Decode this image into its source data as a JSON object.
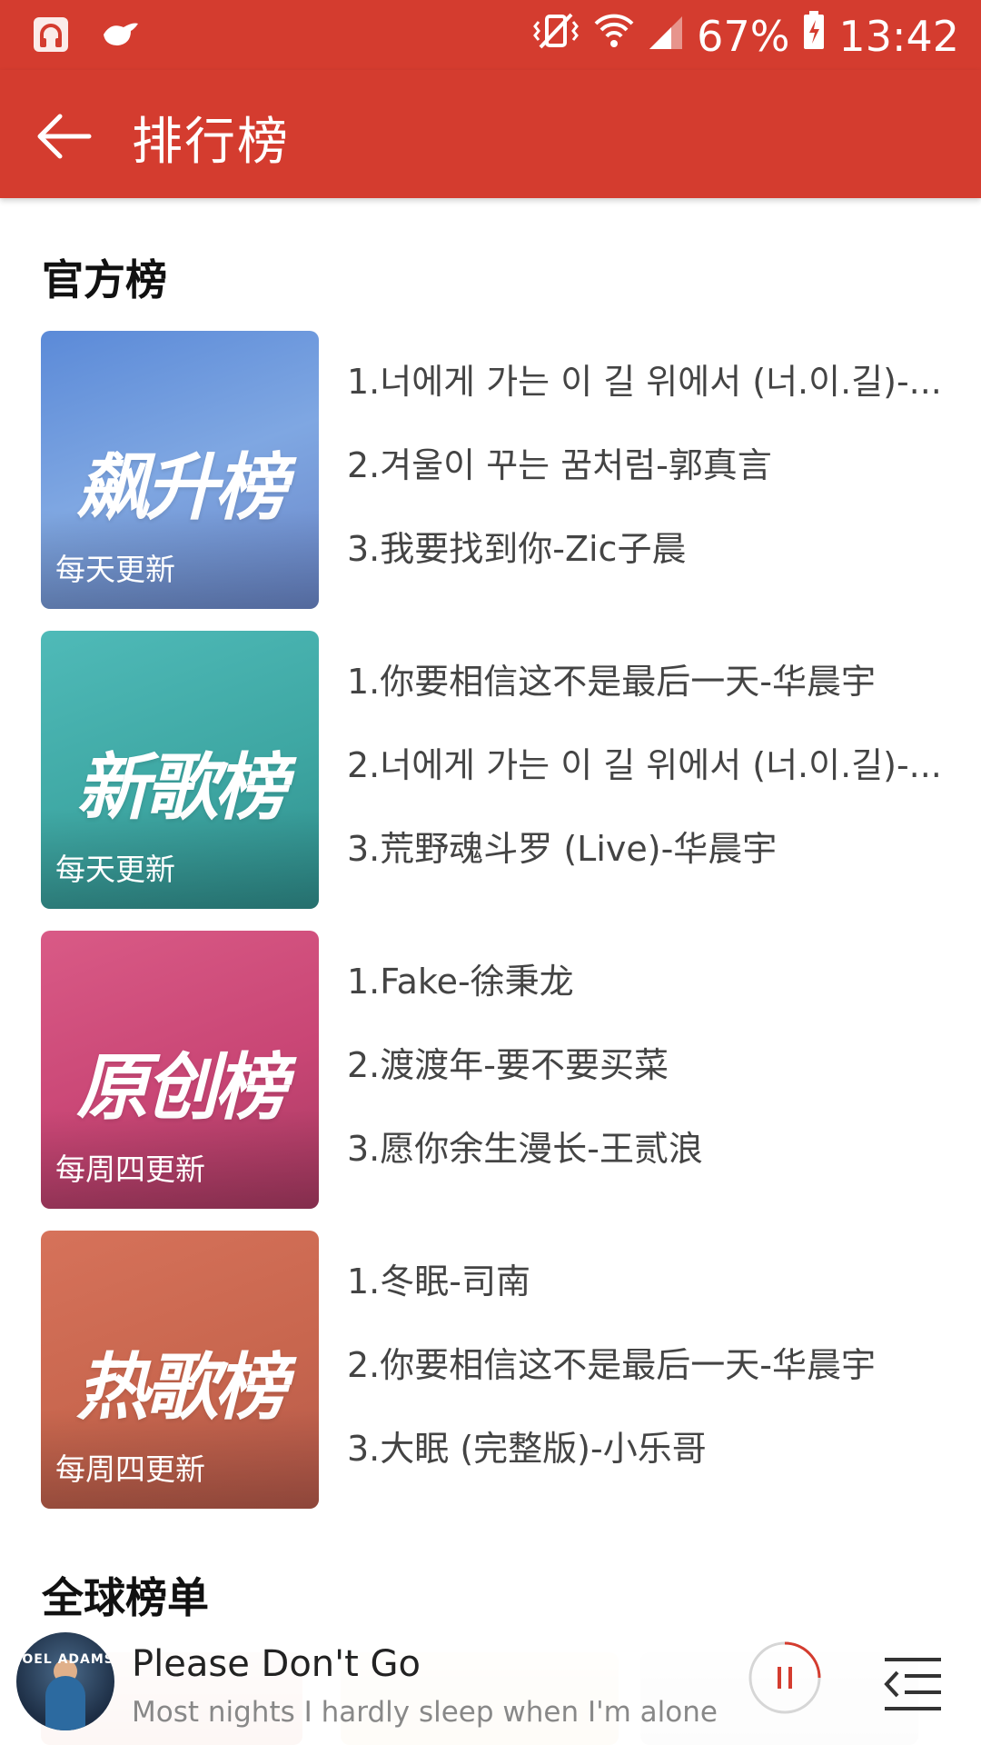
{
  "status_bar": {
    "battery": "67%",
    "time": "13:42"
  },
  "app_bar": {
    "title": "排行榜"
  },
  "sections": {
    "official_title": "官方榜",
    "global_title": "全球榜单"
  },
  "charts": [
    {
      "cover_title": "飙升榜",
      "update_text": "每天更新",
      "gradient": [
        "#5b8ad8",
        "#7fa7e2",
        "#6a86c8"
      ],
      "songs": [
        "1.너에게 가는 이 길 위에서 (너.이.길)-...",
        "2.겨울이 꾸는 꿈처럼-郭真言",
        "3.我要找到你-Zic子晨"
      ]
    },
    {
      "cover_title": "新歌榜",
      "update_text": "每天更新",
      "gradient": [
        "#4fbab8",
        "#3ea7a3",
        "#2f8e8c"
      ],
      "songs": [
        "1.你要相信这不是最后一天-华晨宇",
        "2.너에게 가는 이 길 위에서 (너.이.길)-...",
        "3.荒野魂斗罗 (Live)-华晨宇"
      ]
    },
    {
      "cover_title": "原创榜",
      "update_text": "每周四更新",
      "gradient": [
        "#d95a86",
        "#c94675",
        "#a83a62"
      ],
      "songs": [
        "1.Fake-徐秉龙",
        "2.渡渡年-要不要买菜",
        "3.愿你余生漫长-王贰浪"
      ]
    },
    {
      "cover_title": "热歌榜",
      "update_text": "每周四更新",
      "gradient": [
        "#d6725a",
        "#c8664e",
        "#b5594a"
      ],
      "songs": [
        "1.冬眠-司南",
        "2.你要相信这不是最后一天-华晨宇",
        "3.大眠 (完整版)-小乐哥"
      ]
    }
  ],
  "player": {
    "track_title": "Please Don't Go",
    "lyric": "Most nights I hardly sleep when I'm alone",
    "album_art_text": "JOEL ADAMS"
  },
  "colors": {
    "brand_red": "#d43c2f"
  }
}
